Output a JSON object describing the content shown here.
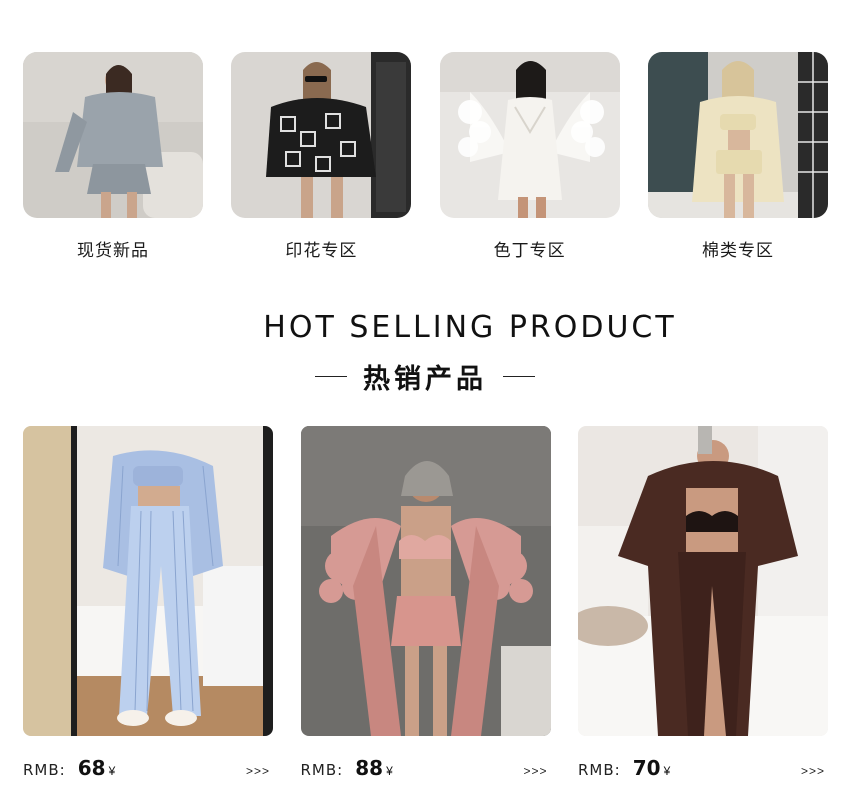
{
  "categories": [
    {
      "label": "现货新品",
      "image_desc": "woman in grey lounge set on sofa"
    },
    {
      "label": "印花专区",
      "image_desc": "woman in black geometric print robe"
    },
    {
      "label": "色丁专区",
      "image_desc": "woman in white satin feather robe"
    },
    {
      "label": "棉类专区",
      "image_desc": "woman in cream cotton set"
    }
  ],
  "section": {
    "title_en": "HOT SELLING PRODUCT",
    "title_cn": "热销产品"
  },
  "products": [
    {
      "currency_label": "RMB:",
      "price": "68",
      "yen": "¥",
      "more": ">>>"
    },
    {
      "currency_label": "RMB:",
      "price": "88",
      "yen": "¥",
      "more": ">>>"
    },
    {
      "currency_label": "RMB:",
      "price": "70",
      "yen": "¥",
      "more": ">>>"
    }
  ],
  "colors": {
    "cat1_bg": "#c9c7c3",
    "cat1_outfit": "#9aa3ab",
    "cat2_bg": "#d9d6d2",
    "cat2_outfit": "#1c1c1c",
    "cat3_bg": "#e8e6e3",
    "cat3_outfit": "#f5f3ef",
    "cat4_bg": "#4a5a5c",
    "cat4_outfit": "#ede3c2",
    "prod1_bg": "#e9e4dc",
    "prod1_outfit": "#a9bfe3",
    "prod2_bg": "#6b6a68",
    "prod2_outfit": "#c88780",
    "prod3_bg": "#ebe7e3",
    "prod3_outfit": "#4a2a22"
  }
}
